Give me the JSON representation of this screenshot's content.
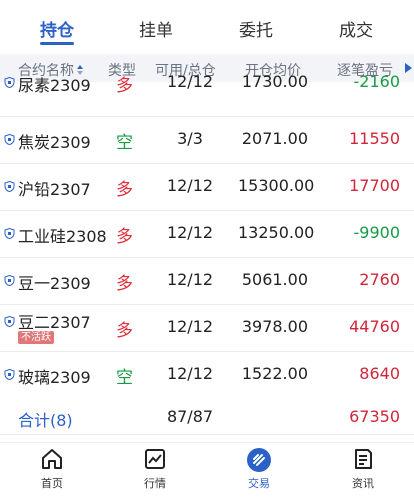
{
  "tabs": [
    {
      "label": "持仓",
      "active": true
    },
    {
      "label": "挂单",
      "active": false
    },
    {
      "label": "委托",
      "active": false
    },
    {
      "label": "成交",
      "active": false
    }
  ],
  "table": {
    "columns": [
      "合约名称",
      "类型",
      "可用/总仓",
      "开仓均价",
      "逐笔盈亏"
    ],
    "rows": [
      {
        "name": "尿素2309",
        "type": "多",
        "avail": "12/12",
        "price": "1730.00",
        "pnl": "-2160",
        "badge": ""
      },
      {
        "name": "焦炭2309",
        "type": "空",
        "avail": "3/3",
        "price": "2071.00",
        "pnl": "11550",
        "badge": ""
      },
      {
        "name": "沪铅2307",
        "type": "多",
        "avail": "12/12",
        "price": "15300.00",
        "pnl": "17700",
        "badge": ""
      },
      {
        "name": "工业硅2308",
        "type": "多",
        "avail": "12/12",
        "price": "13250.00",
        "pnl": "-9900",
        "badge": ""
      },
      {
        "name": "豆一2309",
        "type": "多",
        "avail": "12/12",
        "price": "5061.00",
        "pnl": "2760",
        "badge": ""
      },
      {
        "name": "豆二2307",
        "type": "多",
        "avail": "12/12",
        "price": "3978.00",
        "pnl": "44760",
        "badge": "不活跃"
      },
      {
        "name": "玻璃2309",
        "type": "空",
        "avail": "12/12",
        "price": "1522.00",
        "pnl": "8640",
        "badge": ""
      }
    ]
  },
  "summary": {
    "label": "合计(8)",
    "avail": "87/87",
    "pnl": "67350"
  },
  "nav": [
    {
      "label": "首页",
      "icon": "home-icon"
    },
    {
      "label": "行情",
      "icon": "chart-icon"
    },
    {
      "label": "交易",
      "icon": "trade-icon"
    },
    {
      "label": "资讯",
      "icon": "news-icon"
    }
  ],
  "colors": {
    "accent": "#2c62c7",
    "long": "#e02e3a",
    "short": "#1a9a46",
    "profit": "#d0263a",
    "loss": "#1a9a46"
  }
}
